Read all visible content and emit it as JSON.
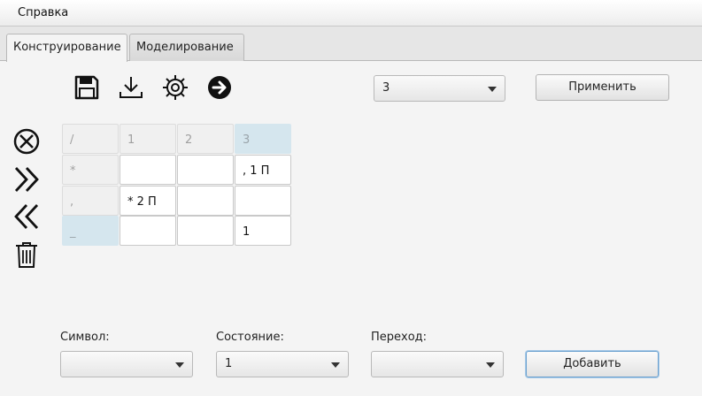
{
  "menu": {
    "help": "Справка"
  },
  "tabs": [
    {
      "label": "Конструирование",
      "active": true
    },
    {
      "label": "Моделирование",
      "active": false
    }
  ],
  "toolbar": {
    "icons": [
      "save-icon",
      "download-icon",
      "gear-icon",
      "arrow-right-circle-icon"
    ],
    "state_count_value": "3",
    "apply_label": "Применить"
  },
  "sidebar": {
    "icons": [
      "cancel-circle-icon",
      "shift-right-icon",
      "shift-left-icon",
      "trash-icon"
    ]
  },
  "table": {
    "corner": "/",
    "columns": [
      "1",
      "2",
      "3"
    ],
    "rows": [
      {
        "symbol": "*",
        "cells": [
          "",
          "",
          ", 1 П"
        ]
      },
      {
        "symbol": ",",
        "cells": [
          "* 2 П",
          "",
          ""
        ]
      },
      {
        "symbol": "_",
        "cells": [
          "",
          "",
          "1"
        ]
      }
    ]
  },
  "form": {
    "symbol_label": "Символ:",
    "symbol_value": "",
    "state_label": "Состояние:",
    "state_value": "1",
    "transition_label": "Переход:",
    "transition_value": "",
    "add_label": "Добавить"
  },
  "colors": {
    "background": "#f4f4f4",
    "highlight": "#d5e6ee",
    "focus_border": "#6aa0cf"
  }
}
